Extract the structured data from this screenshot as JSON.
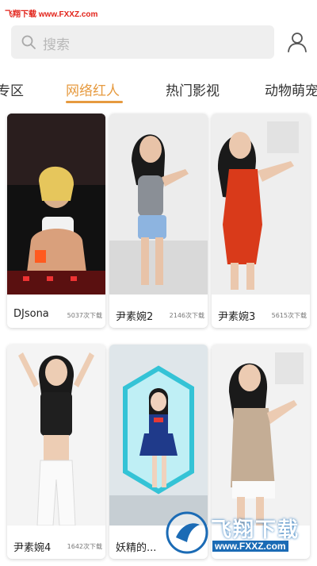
{
  "watermark": {
    "top_text": "飞翔下载 www.FXXZ.com",
    "logo_name": "飞翔下载",
    "logo_url": "www.FXXZ.com"
  },
  "search": {
    "placeholder": "搜索"
  },
  "tabs": [
    {
      "label": "专区",
      "active": false
    },
    {
      "label": "网络红人",
      "active": true
    },
    {
      "label": "热门影视",
      "active": false
    },
    {
      "label": "动物萌宠",
      "active": false
    }
  ],
  "colors": {
    "accent": "#e69a3f",
    "watermark_red": "#e2231a",
    "watermark_blue": "#1b6bb5"
  },
  "cards": [
    {
      "title": "DJsona",
      "count": "5037次下载"
    },
    {
      "title": "尹素婉2",
      "count": "2146次下载"
    },
    {
      "title": "尹素婉3",
      "count": "5615次下载"
    },
    {
      "title": "尹素婉4",
      "count": "1642次下载"
    },
    {
      "title": "妖精的...",
      "count": ""
    },
    {
      "title": "",
      "count": ""
    }
  ]
}
